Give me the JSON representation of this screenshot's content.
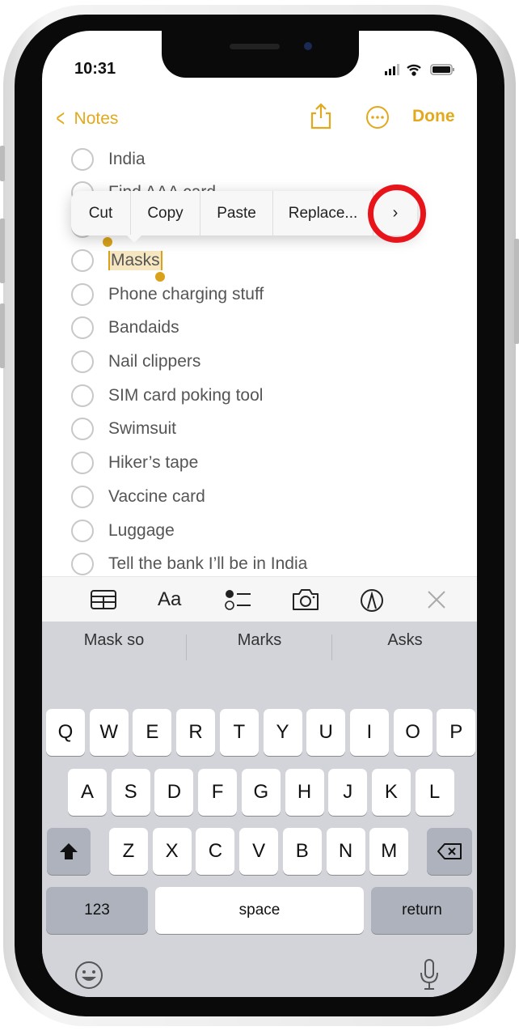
{
  "status": {
    "time": "10:31"
  },
  "nav": {
    "back_label": "Notes",
    "done_label": "Done"
  },
  "checklist": [
    "India",
    "Find AAA card",
    "",
    "Masks",
    "Phone charging stuff",
    "Bandaids",
    "Nail clippers",
    "SIM card poking tool",
    "Swimsuit",
    "Hiker’s tape",
    "Vaccine card",
    "Luggage",
    "Tell the bank I’ll be in India"
  ],
  "selected_text": "Masks",
  "edit_menu": {
    "items": [
      "Cut",
      "Copy",
      "Paste",
      "Replace..."
    ],
    "more_icon": "chevron-right-icon",
    "highlight_color": "#e8141b"
  },
  "toolbar": {
    "icons": [
      "table-icon",
      "text-format-icon",
      "checklist-icon",
      "camera-icon",
      "markup-icon",
      "close-icon"
    ],
    "format_label": "Aa"
  },
  "suggestions": [
    "Mask so",
    "Marks",
    "Asks"
  ],
  "keyboard": {
    "row1": [
      "Q",
      "W",
      "E",
      "R",
      "T",
      "Y",
      "U",
      "I",
      "O",
      "P"
    ],
    "row2": [
      "A",
      "S",
      "D",
      "F",
      "G",
      "H",
      "J",
      "K",
      "L"
    ],
    "row3": [
      "Z",
      "X",
      "C",
      "V",
      "B",
      "N",
      "M"
    ],
    "numbers_label": "123",
    "space_label": "space",
    "return_label": "return"
  },
  "colors": {
    "accent": "#e3a91c",
    "keyboard_bg": "#d2d4da"
  }
}
